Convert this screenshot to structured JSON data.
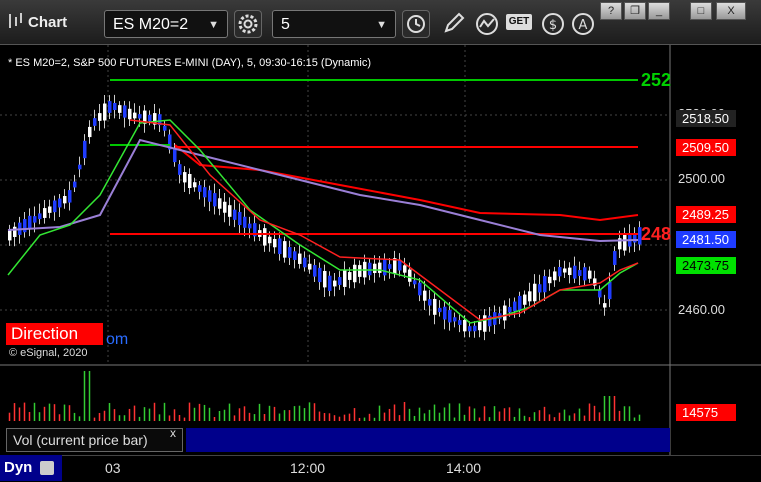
{
  "window": {
    "title": "Chart",
    "minimize": "_",
    "restore": "❐",
    "maximize": "□",
    "close": "X"
  },
  "toolbar": {
    "symbol_value": "ES M20=2",
    "interval_value": "5",
    "dropdown_arrow": "▼",
    "icons": [
      "gear-icon",
      "clock-icon",
      "pencil-icon",
      "study-icon",
      "get-icon",
      "dollar-icon",
      "annotation-icon"
    ],
    "get_label": "GET"
  },
  "chart": {
    "symbol_label": "* ES M20=2, S&P 500 FUTURES E-MINI (DAY), 5, 09:30-16:15 (Dynamic)",
    "copyright": "© eSignal, 2020",
    "direction_label": "Direction",
    "direction_tail": "om",
    "right_green_label": "252",
    "right_red_label": "248",
    "colors": {
      "green_line": "#00c800",
      "red_line": "#ff0000",
      "purple_line": "#9a7fd6",
      "bar_blue": "#1f3cff",
      "bar_white": "#ffffff",
      "ma_red": "#ff2020",
      "ma_green": "#33e633"
    }
  },
  "axis": {
    "price_labels": [
      "2520.00",
      "2500.00",
      "2460.00"
    ],
    "time_labels": [
      "03",
      "12:00",
      "14:00"
    ]
  },
  "price_tags": [
    {
      "value": "2518.50",
      "bg": "#222222",
      "fg": "#ffffff"
    },
    {
      "value": "2509.50",
      "bg": "#ff0000",
      "fg": "#ffffff"
    },
    {
      "value": "2489.25",
      "bg": "#ff0000",
      "fg": "#ffffff"
    },
    {
      "value": "2481.50",
      "bg": "#1f3cff",
      "fg": "#ffffff"
    },
    {
      "value": "2473.75",
      "bg": "#00e000",
      "fg": "#000000"
    }
  ],
  "volume": {
    "panel_label": "Vol (current price bar)",
    "close_label": "x",
    "value_tag": "14575"
  },
  "status": {
    "dyn_label": "Dyn"
  }
}
